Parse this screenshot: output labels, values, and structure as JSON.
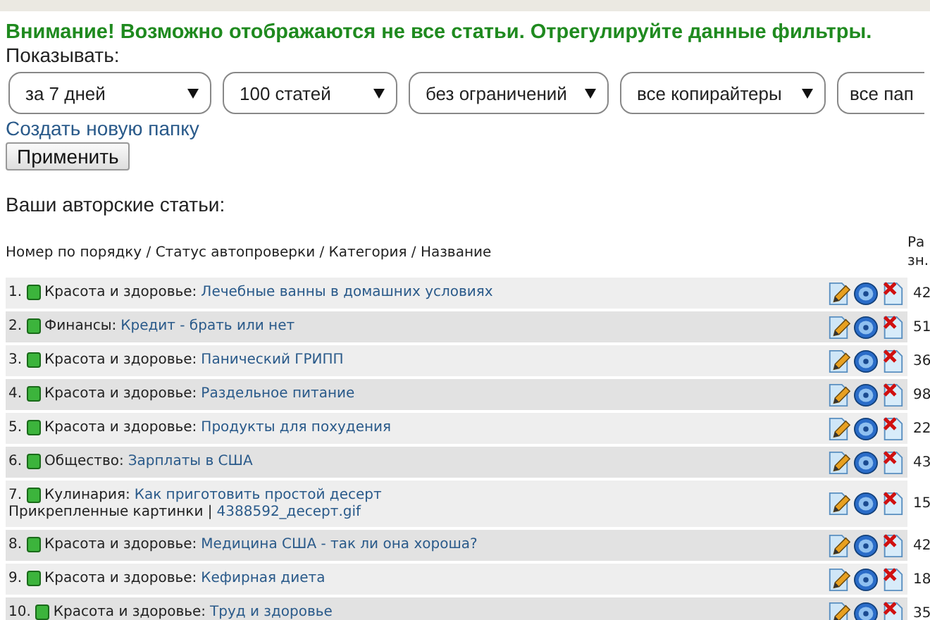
{
  "warning": "Внимание! Возможно отображаются не все статьи. Отрегулируйте данные фильтры.",
  "filter_label": "Показывать:",
  "filters": [
    "за 7 дней",
    "100 статей",
    "без ограничений",
    "все копирайтеры",
    "все пап"
  ],
  "create_folder_link": "Создать новую папку",
  "apply_button": "Применить",
  "section_title": "Ваши авторские статьи:",
  "table": {
    "columns": [
      "Номер по порядку / Статус автопроверки / Категория / Название",
      "Ра зн."
    ],
    "rows": [
      {
        "number": "1.",
        "color": "#3cb43c",
        "category": "Красота и здоровье:",
        "title": "Лечебные ванны в домашних условиях",
        "value": "42"
      },
      {
        "number": "2.",
        "color": "#3cb43c",
        "category": "Финансы:",
        "title": "Кредит - брать или нет",
        "value": "51"
      },
      {
        "number": "3.",
        "color": "#3cb43c",
        "category": "Красота и здоровье:",
        "title": "Панический ГРИПП",
        "value": "36"
      },
      {
        "number": "4.",
        "color": "#3cb43c",
        "category": "Красота и здоровье:",
        "title": "Раздельное питание",
        "value": "98"
      },
      {
        "number": "5.",
        "color": "#3cb43c",
        "category": "Красота и здоровье:",
        "title": "Продукты для похудения",
        "value": "22"
      },
      {
        "number": "6.",
        "color": "#3cb43c",
        "category": "Общество:",
        "title": "Зарплаты в США",
        "value": "43"
      },
      {
        "number": "7.",
        "color": "#3cb43c",
        "category": "Кулинария:",
        "title": "Как приготовить простой десерт",
        "value": "15",
        "attachment": {
          "label": "Прикрепленные картинки |",
          "file": "4388592_десерт.gif"
        }
      },
      {
        "number": "8.",
        "color": "#3cb43c",
        "category": "Красота и здоровье:",
        "title": "Медицина США - так ли она хороша?",
        "value": "42"
      },
      {
        "number": "9.",
        "color": "#3cb43c",
        "category": "Красота и здоровье:",
        "title": "Кефирная диета",
        "value": "18"
      },
      {
        "number": "10.",
        "color": "#3cb43c",
        "category": "Красота и здоровье:",
        "title": "Труд и здоровье",
        "value": "35"
      }
    ]
  }
}
